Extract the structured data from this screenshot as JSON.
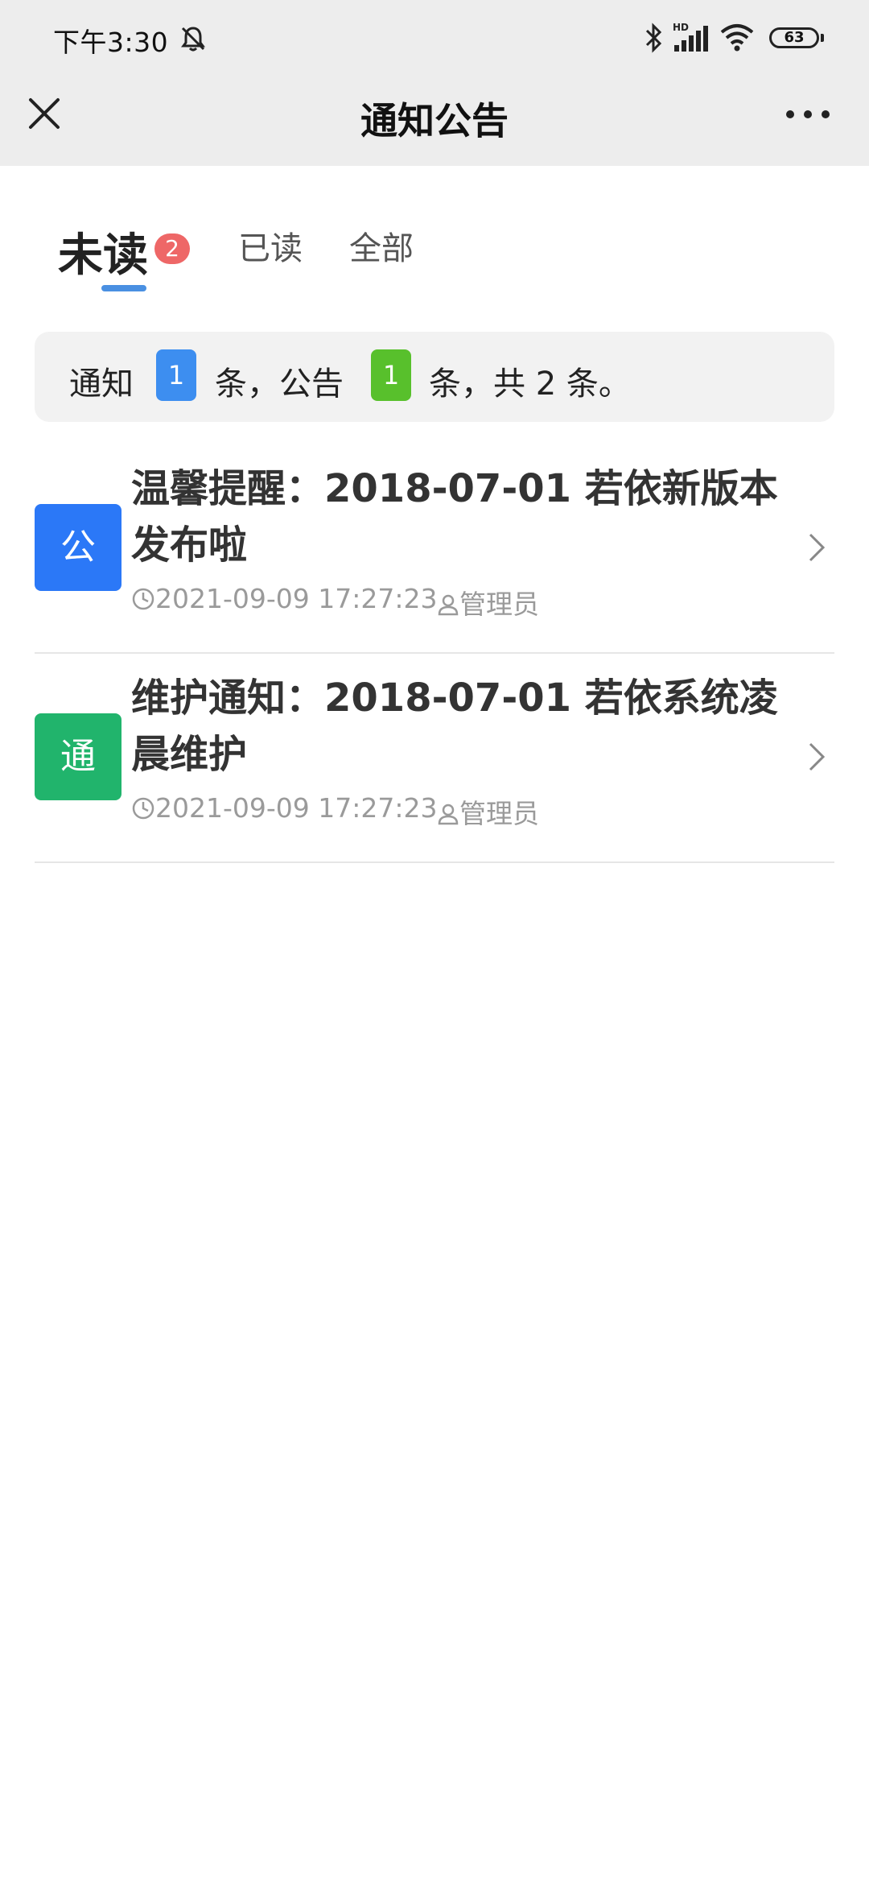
{
  "status_bar": {
    "time": "下午3:30",
    "battery": "63",
    "icons": [
      "mute-bell-icon",
      "bluetooth-icon",
      "hd-signal-icon",
      "wifi-icon",
      "battery-icon"
    ]
  },
  "nav": {
    "title": "通知公告",
    "close_icon": "close-icon",
    "more_icon": "more-icon"
  },
  "tabs": {
    "unread_label": "未读",
    "unread_badge": "2",
    "read_label": "已读",
    "all_label": "全部",
    "active": "unread",
    "underline_color": "#4a90e2",
    "badge_color": "#ee6767"
  },
  "summary": {
    "part1": "通知",
    "notice_count": "1",
    "part2": "条，公告",
    "announcement_count": "1",
    "part3": "条，共 2 条。",
    "notice_color": "#3d8ef0",
    "announcement_color": "#58c02c"
  },
  "items": [
    {
      "badge": "公",
      "badge_color": "#2b78f7",
      "title": "温馨提醒：2018-07-01 若依新版本发布啦",
      "time": "2021-09-09 17:27:23",
      "author": "管理员"
    },
    {
      "badge": "通",
      "badge_color": "#21b46c",
      "title": "维护通知：2018-07-01 若依系统凌晨维护",
      "time": "2021-09-09 17:27:23",
      "author": "管理员"
    }
  ]
}
